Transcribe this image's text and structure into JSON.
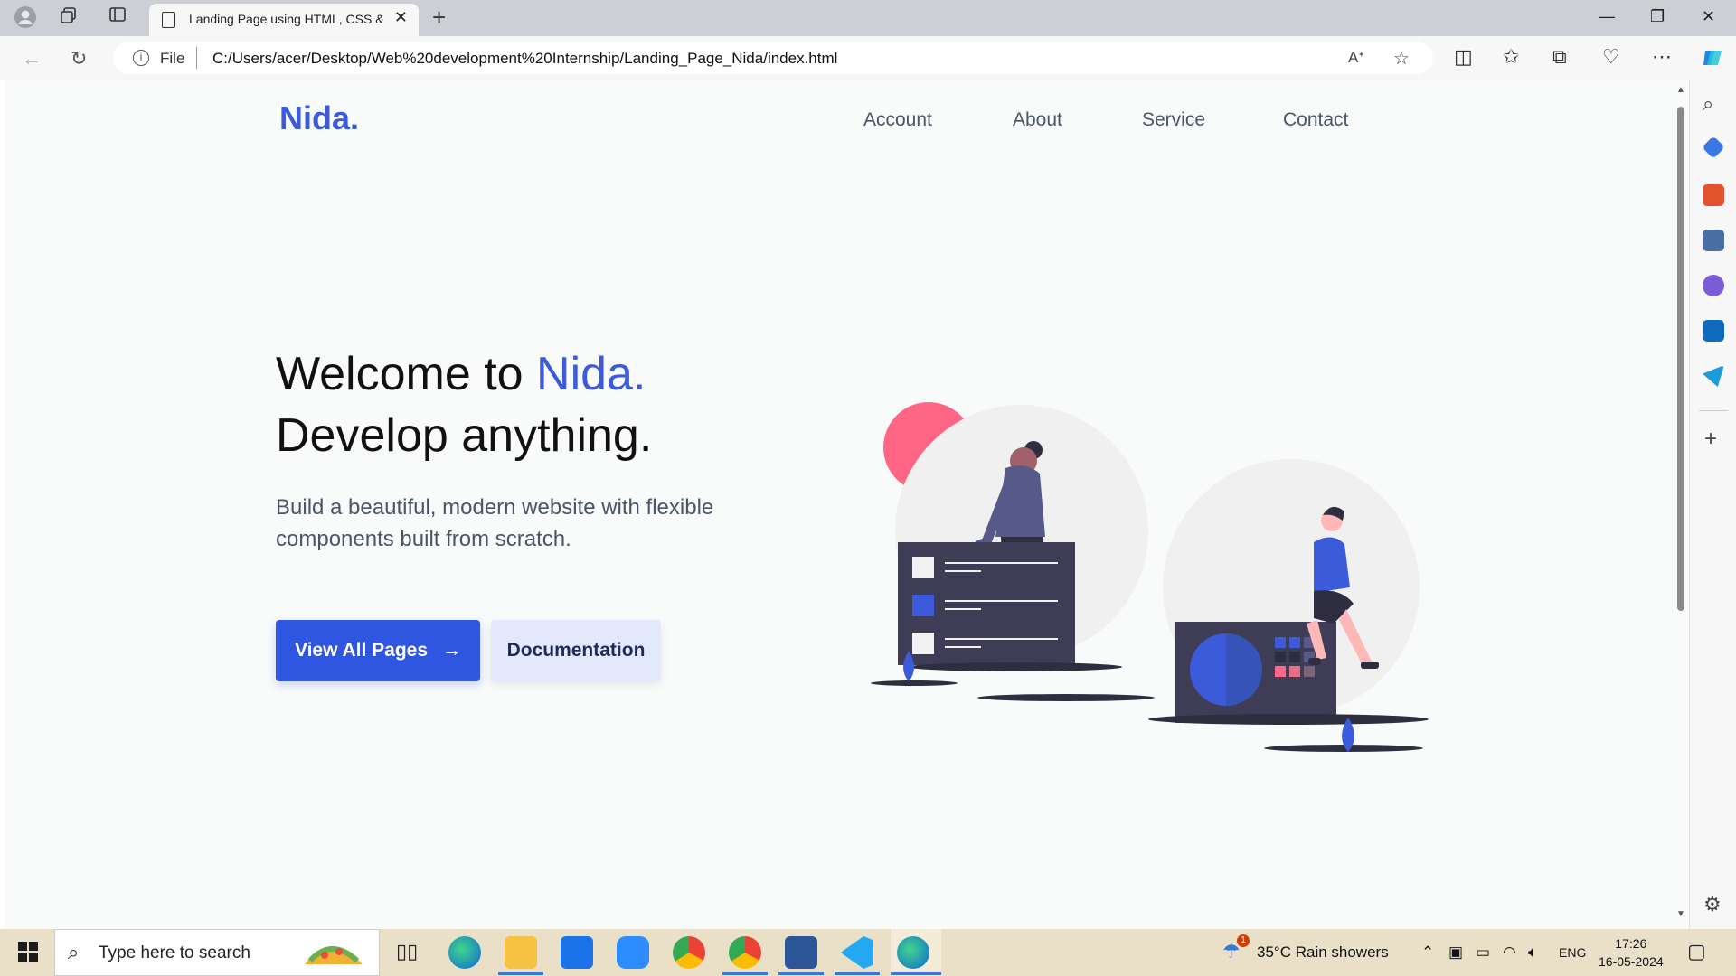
{
  "browser": {
    "tab_title": "Landing Page using HTML, CSS & JS",
    "address": {
      "scheme_label": "File",
      "url": "C:/Users/acer/Desktop/Web%20development%20Internship/Landing_Page_Nida/index.html"
    }
  },
  "page": {
    "logo": "Nida.",
    "nav": [
      "Account",
      "About",
      "Service",
      "Contact"
    ],
    "hero": {
      "title_prefix": "Welcome to ",
      "title_accent": "Nida.",
      "title_line2": "Develop anything.",
      "subtitle": "Build a beautiful, modern website with flexible components built from scratch.",
      "primary_button": "View All Pages",
      "secondary_button": "Documentation"
    }
  },
  "taskbar": {
    "search_placeholder": "Type here to search",
    "weather": "35°C  Rain showers",
    "weather_badge": "1",
    "language": "ENG",
    "time": "17:26",
    "date": "16-05-2024"
  },
  "colors": {
    "accent": "#3b5bdb",
    "primary_button": "#2f56e0",
    "secondary_button": "#e4e8fb",
    "illustration_dark": "#3f3d56",
    "illustration_pink": "#ff6584"
  }
}
